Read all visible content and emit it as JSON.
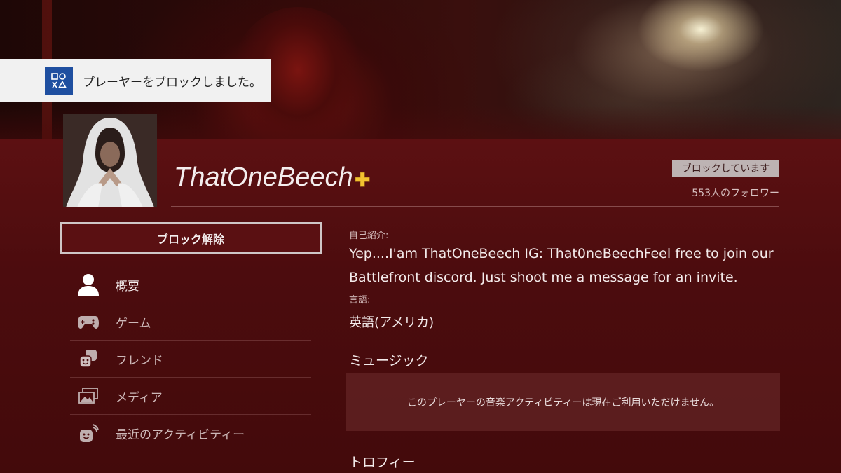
{
  "notification": {
    "icon": "playstation-logo-icon",
    "text": "プレーヤーをブロックしました。"
  },
  "profile": {
    "username": "ThatOneBeech",
    "plus_icon": "ps-plus-icon",
    "blocked_badge": "ブロックしています",
    "followers": "553人のフォロワー"
  },
  "actions": {
    "unblock_label": "ブロック解除"
  },
  "menu": {
    "items": [
      {
        "label": "概要",
        "icon": "profile-icon",
        "active": true
      },
      {
        "label": "ゲーム",
        "icon": "gamepad-icon",
        "active": false
      },
      {
        "label": "フレンド",
        "icon": "friends-icon",
        "active": false
      },
      {
        "label": "メディア",
        "icon": "media-icon",
        "active": false
      },
      {
        "label": "最近のアクティビティー",
        "icon": "activity-icon",
        "active": false
      }
    ]
  },
  "about": {
    "bio_label": "自己紹介:",
    "bio_line1": "Yep....I'am ThatOneBeech IG: That0neBeechFeel free to join our",
    "bio_line2": "Battlefront discord. Just shoot me a message for an invite.",
    "language_label": "言語:",
    "language_value": "英語(アメリカ)"
  },
  "music": {
    "title": "ミュージック",
    "message": "このプレーヤーの音楽アクティビティーは現在ご利用いただけません。"
  },
  "trophies": {
    "title": "トロフィー"
  },
  "colors": {
    "background": "#4a0b0c",
    "notification_bg": "#f1f1f1",
    "playstation_blue": "#1f4fa0",
    "plus_gold": "#f2c230"
  }
}
